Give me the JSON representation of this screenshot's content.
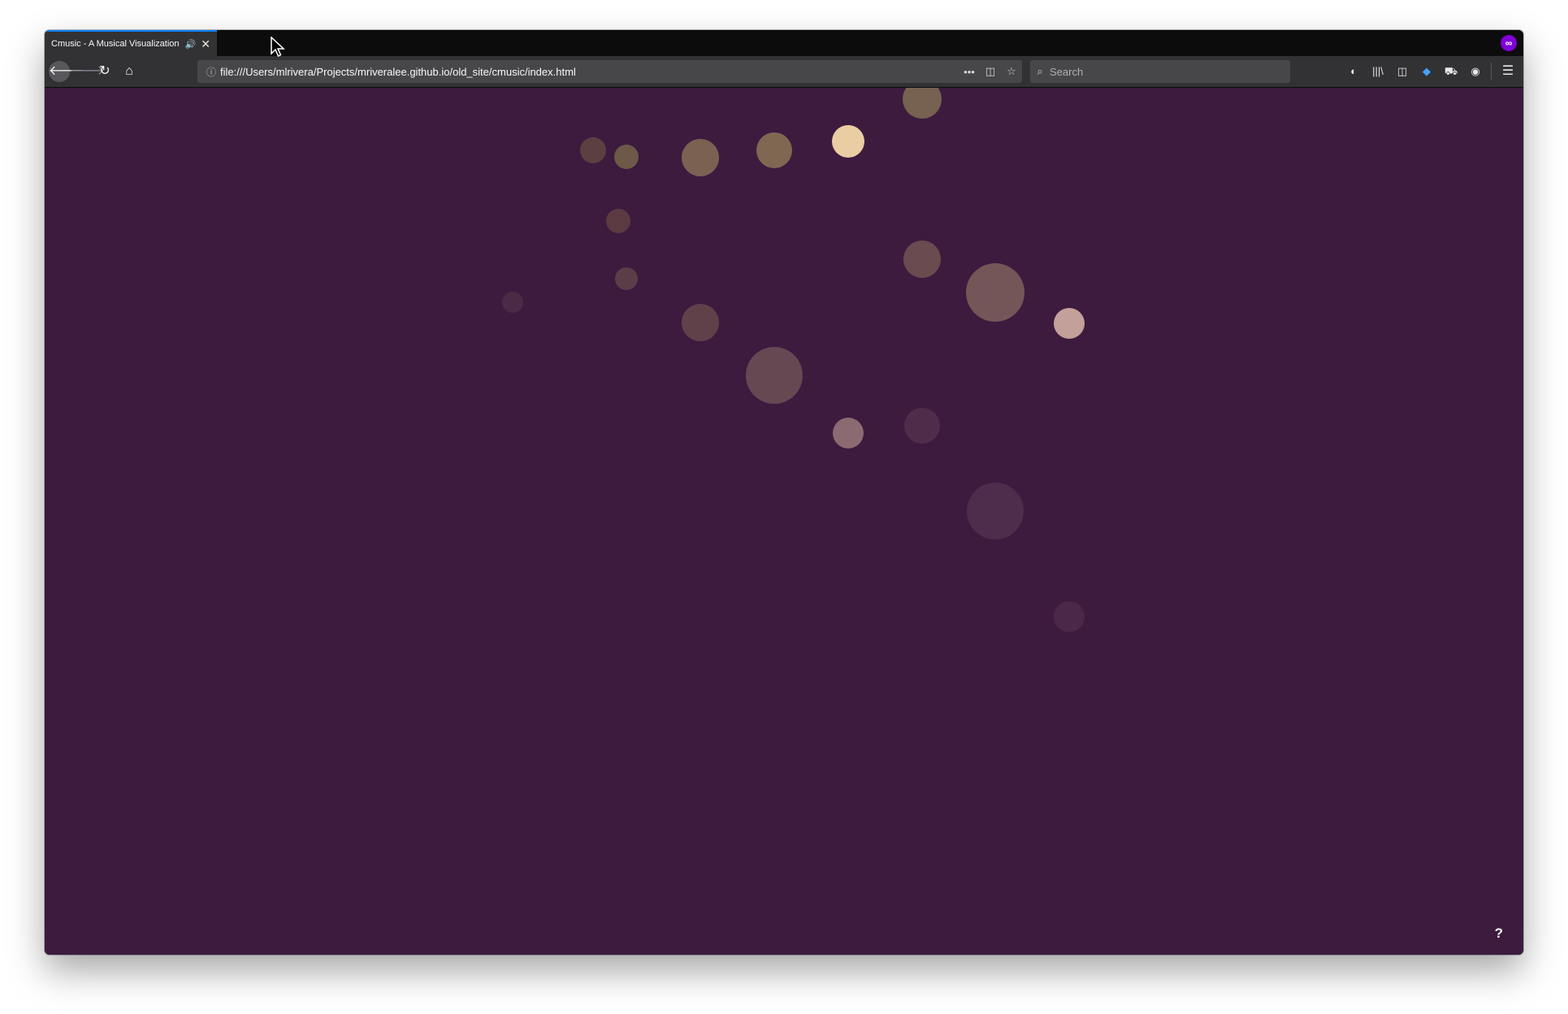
{
  "tab": {
    "title": "Cmusic - A Musical Visualization",
    "audio_icon": "speaker-icon",
    "close_label": "✕"
  },
  "private_badge": "∞",
  "nav": {
    "back": "🡐",
    "forward": "🡒",
    "reload": "↻",
    "home": "⌂"
  },
  "urlbar": {
    "info_icon": "ⓘ",
    "url": "file:///Users/mlrivera/Projects/mriveralee.github.io/old_site/cmusic/index.html",
    "more": "•••",
    "pocket": "◫",
    "bookmark": "☆"
  },
  "searchbar": {
    "icon": "⌕",
    "placeholder": "Search"
  },
  "toolbar": {
    "icons": [
      "◐",
      "|||\\",
      "◫",
      "◆",
      "⛟",
      "◉"
    ],
    "menu": "☰"
  },
  "page": {
    "background": "#3c1b3f",
    "help_label": "?"
  },
  "visualization": {
    "circles": [
      {
        "color": "#776150",
        "opacity": 1
      },
      {
        "color": "#5a4040",
        "opacity": 1
      },
      {
        "color": "#6e5848",
        "opacity": 1
      },
      {
        "color": "#7a6252",
        "opacity": 1
      },
      {
        "color": "#7f6752",
        "opacity": 1
      },
      {
        "color": "#ebcda3",
        "opacity": 1
      },
      {
        "color": "#5b3a42",
        "opacity": 1
      },
      {
        "color": "#5b3d48",
        "opacity": 1
      },
      {
        "color": "#694b50",
        "opacity": 1
      },
      {
        "color": "#755658",
        "opacity": 1
      },
      {
        "color": "#4a2a45",
        "opacity": 1
      },
      {
        "color": "#614149",
        "opacity": 1
      },
      {
        "color": "#654852",
        "opacity": 1
      },
      {
        "color": "#c4a09a",
        "opacity": 1
      },
      {
        "color": "#8b6a71",
        "opacity": 1
      },
      {
        "color": "#4f2c4a",
        "opacity": 1
      },
      {
        "color": "#4e2c4c",
        "opacity": 1
      },
      {
        "color": "#4b2849",
        "opacity": 1
      }
    ]
  }
}
